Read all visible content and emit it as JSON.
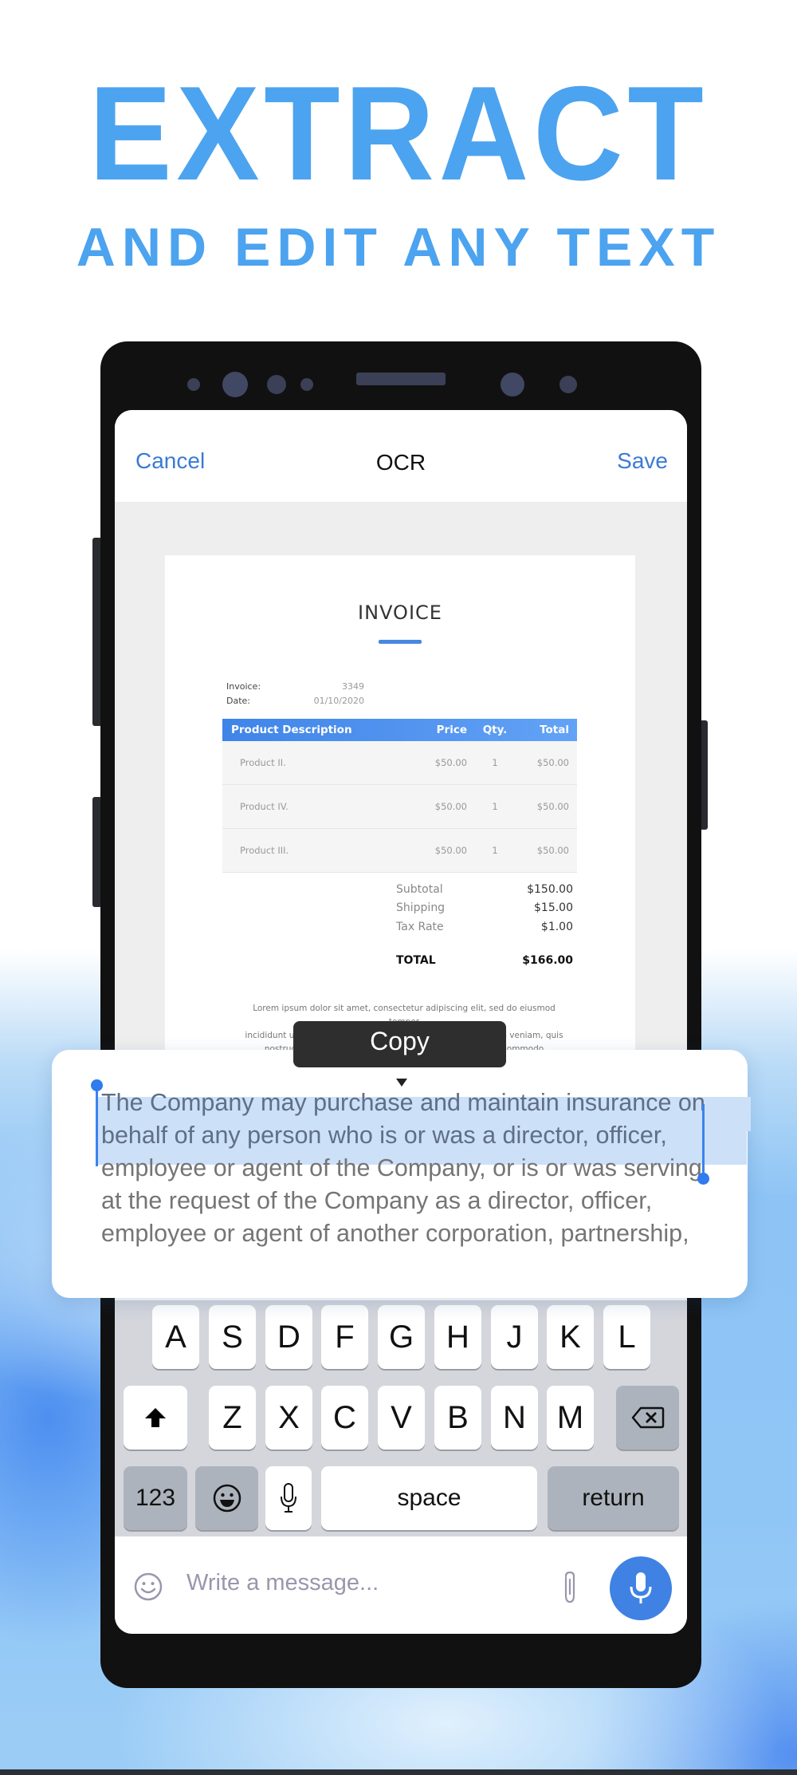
{
  "promo": {
    "headline": "EXTRACT",
    "subheadline": "AND EDIT ANY TEXT",
    "accent_color": "#4ca3ef"
  },
  "app": {
    "nav": {
      "cancel_label": "Cancel",
      "title": "OCR",
      "save_label": "Save",
      "link_color": "#3a7bd5"
    },
    "invoice": {
      "title": "INVOICE",
      "meta": [
        {
          "label": "Invoice:",
          "value": "3349"
        },
        {
          "label": "Date:",
          "value": "01/10/2020"
        }
      ],
      "columns": [
        "Product Description",
        "Price",
        "Qty.",
        "Total"
      ],
      "rows": [
        [
          "Product II.",
          "$50.00",
          "1",
          "$50.00"
        ],
        [
          "Product IV.",
          "$50.00",
          "1",
          "$50.00"
        ],
        [
          "Product III.",
          "$50.00",
          "1",
          "$50.00"
        ]
      ],
      "summary": [
        {
          "label": "Subtotal",
          "value": "$150.00"
        },
        {
          "label": "Shipping",
          "value": "$15.00"
        },
        {
          "label": "Tax Rate",
          "value": "$1.00"
        }
      ],
      "total": {
        "label": "TOTAL",
        "value": "$166.00"
      },
      "footer_text": [
        "Lorem ipsum dolor sit amet, consectetur adipiscing elit, sed do eiusmod tempor",
        "incididunt ut labore et dolore magna aliqua. Ut enim ad minim veniam, quis",
        "nostrud exercitation ullamco laboris nisi ut aliquip ex ea commodo consequat."
      ]
    },
    "context_menu": {
      "copy_label": "Copy"
    },
    "recognized_text": {
      "selected_lines": [
        "The Company may purchase and maintain insurance on",
        "behalf of any person who is or was a director, officer,"
      ],
      "unselected_lines": [
        "employee or agent of the Company, or is or was serving",
        "at the request of the Company as a director, officer,",
        "employee or agent of another corporation, partnership,"
      ],
      "selection_color": "#cce0f8",
      "handle_color": "#2f7bef"
    },
    "keyboard": {
      "row1": [
        "A",
        "S",
        "D",
        "F",
        "G",
        "H",
        "J",
        "K",
        "L"
      ],
      "row2": [
        "Z",
        "X",
        "C",
        "V",
        "B",
        "N",
        "M"
      ],
      "numbers_label": "123",
      "space_label": "space",
      "return_label": "return"
    },
    "composer": {
      "placeholder": "Write a message...",
      "fab_color": "#3f82e3"
    }
  }
}
